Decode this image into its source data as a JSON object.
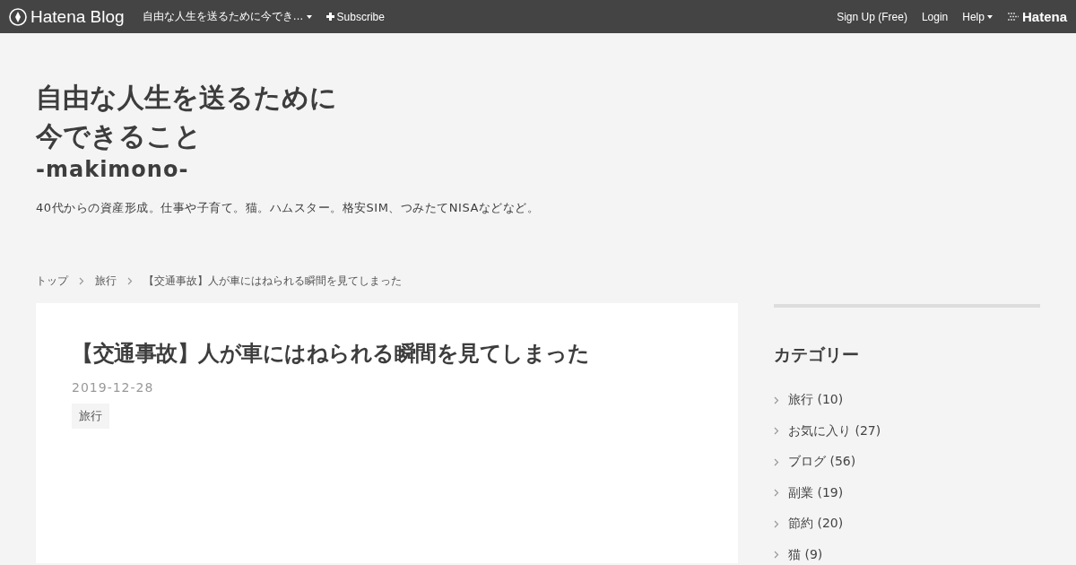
{
  "topbar": {
    "logo": "Hatena Blog",
    "blog_menu": "自由な人生を送るために今でき…",
    "subscribe": "Subscribe",
    "links": [
      "Sign Up (Free)",
      "Login"
    ],
    "help": "Help",
    "brand": "Hatena"
  },
  "header": {
    "title_lines": [
      "自由な人生を送るために",
      "今できること"
    ],
    "subtitle": "-makimono-",
    "description": "40代からの資産形成。仕事や子育て。猫。ハムスター。格安SIM、つみたてNISAなどなど。"
  },
  "breadcrumb": [
    "トップ",
    "旅行",
    "【交通事故】人が車にはねられる瞬間を見てしまった"
  ],
  "article": {
    "title": "【交通事故】人が車にはねられる瞬間を見てしまった",
    "date": "2019-12-28",
    "categories": [
      "旅行"
    ]
  },
  "sidebar": {
    "heading": "カテゴリー",
    "items": [
      {
        "label": "旅行 (10)"
      },
      {
        "label": "お気に入り (27)"
      },
      {
        "label": "ブログ (56)"
      },
      {
        "label": "副業 (19)"
      },
      {
        "label": "節約 (20)"
      },
      {
        "label": "猫 (9)"
      }
    ]
  }
}
